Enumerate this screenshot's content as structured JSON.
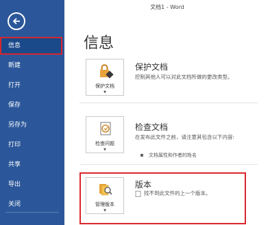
{
  "window": {
    "title": "文档1 - Word"
  },
  "sidebar": {
    "items": [
      {
        "label": "信息",
        "selected": true
      },
      {
        "label": "新建"
      },
      {
        "label": "打开"
      },
      {
        "label": "保存"
      },
      {
        "label": "另存为"
      },
      {
        "label": "打印"
      },
      {
        "label": "共享"
      },
      {
        "label": "导出"
      },
      {
        "label": "关闭"
      }
    ]
  },
  "main": {
    "title": "信息",
    "sections": [
      {
        "tile_label": "保护文档",
        "title": "保护文档",
        "description": "控制其他人可以对此文档所做的更改类型。",
        "icon": "lock-document-icon"
      },
      {
        "tile_label": "检查问题",
        "title": "检查文档",
        "description": "在发布此文件之前，请注意其包含以下内容:",
        "bullets": [
          "文档属性和作者的姓名"
        ],
        "icon": "inspect-document-icon"
      },
      {
        "tile_label": "管理版本",
        "title": "版本",
        "description": "找不到此文件的上一个版本。",
        "icon": "manage-versions-icon"
      }
    ]
  },
  "colors": {
    "sidebar": "#2b579a",
    "highlight": "#d9262b"
  }
}
